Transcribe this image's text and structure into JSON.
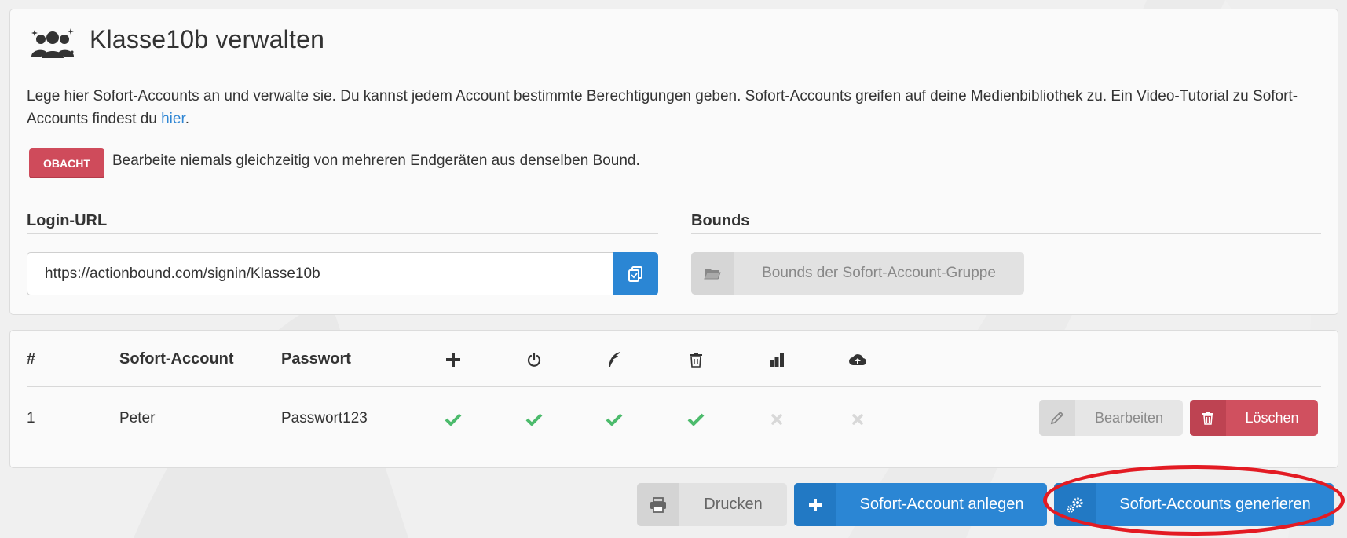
{
  "header": {
    "title": "Klasse10b verwalten"
  },
  "intro": {
    "text_before_link": "Lege hier Sofort-Accounts an und verwalte sie. Du kannst jedem Account bestimmte Berechtigungen geben. Sofort-Accounts greifen auf deine Medienbibliothek zu. Ein Video-Tutorial zu Sofort-Accounts findest du ",
    "link_text": "hier",
    "text_after_link": "."
  },
  "warning": {
    "badge": "OBACHT",
    "text": "Bearbeite niemals gleichzeitig von mehreren Endgeräten aus denselben Bound."
  },
  "login": {
    "label": "Login-URL",
    "url_value": "https://actionbound.com/signin/Klasse10b"
  },
  "bounds": {
    "label": "Bounds",
    "button_label": "Bounds der Sofort-Account-Gruppe"
  },
  "table": {
    "headers": {
      "number": "#",
      "account": "Sofort-Account",
      "password": "Passwort"
    },
    "permission_icons": [
      "plus-icon",
      "power-icon",
      "feather-icon",
      "trash-icon",
      "bar-chart-icon",
      "cloud-upload-icon"
    ],
    "rows": [
      {
        "number": "1",
        "account": "Peter",
        "password": "Passwort123",
        "permissions": [
          true,
          true,
          true,
          true,
          false,
          false
        ]
      }
    ],
    "edit_label": "Bearbeiten",
    "delete_label": "Löschen"
  },
  "actions": {
    "print_label": "Drucken",
    "add_label": "Sofort-Account anlegen",
    "generate_label": "Sofort-Accounts generieren"
  },
  "colors": {
    "primary": "#2b86d4",
    "danger": "#d0505f",
    "success": "#4cbb6c",
    "disabled": "#d6d6d6",
    "highlight": "#e31b23"
  }
}
